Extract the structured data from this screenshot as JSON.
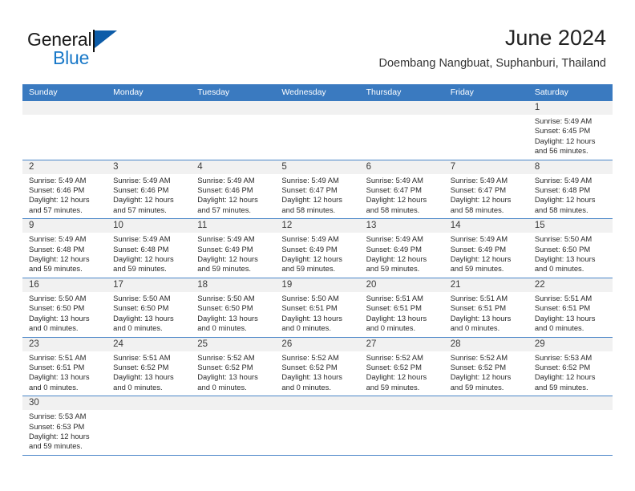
{
  "brand": {
    "name_top": "General",
    "name_bottom": "Blue",
    "logo_icon": "blue-flag-triangle",
    "color_primary": "#1878c8",
    "color_dark": "#0d5ca8"
  },
  "header": {
    "month_title": "June 2024",
    "location": "Doembang Nangbuat, Suphanburi, Thailand"
  },
  "calendar": {
    "header_bg": "#3a7ac0",
    "daynum_bg": "#f1f1f1",
    "row_border": "#4a86c8",
    "weekday_headers": [
      "Sunday",
      "Monday",
      "Tuesday",
      "Wednesday",
      "Thursday",
      "Friday",
      "Saturday"
    ],
    "weeks": [
      [
        {
          "day": "",
          "sunrise": "",
          "sunset": "",
          "daylight": ""
        },
        {
          "day": "",
          "sunrise": "",
          "sunset": "",
          "daylight": ""
        },
        {
          "day": "",
          "sunrise": "",
          "sunset": "",
          "daylight": ""
        },
        {
          "day": "",
          "sunrise": "",
          "sunset": "",
          "daylight": ""
        },
        {
          "day": "",
          "sunrise": "",
          "sunset": "",
          "daylight": ""
        },
        {
          "day": "",
          "sunrise": "",
          "sunset": "",
          "daylight": ""
        },
        {
          "day": "1",
          "sunrise": "Sunrise: 5:49 AM",
          "sunset": "Sunset: 6:45 PM",
          "daylight": "Daylight: 12 hours and 56 minutes."
        }
      ],
      [
        {
          "day": "2",
          "sunrise": "Sunrise: 5:49 AM",
          "sunset": "Sunset: 6:46 PM",
          "daylight": "Daylight: 12 hours and 57 minutes."
        },
        {
          "day": "3",
          "sunrise": "Sunrise: 5:49 AM",
          "sunset": "Sunset: 6:46 PM",
          "daylight": "Daylight: 12 hours and 57 minutes."
        },
        {
          "day": "4",
          "sunrise": "Sunrise: 5:49 AM",
          "sunset": "Sunset: 6:46 PM",
          "daylight": "Daylight: 12 hours and 57 minutes."
        },
        {
          "day": "5",
          "sunrise": "Sunrise: 5:49 AM",
          "sunset": "Sunset: 6:47 PM",
          "daylight": "Daylight: 12 hours and 58 minutes."
        },
        {
          "day": "6",
          "sunrise": "Sunrise: 5:49 AM",
          "sunset": "Sunset: 6:47 PM",
          "daylight": "Daylight: 12 hours and 58 minutes."
        },
        {
          "day": "7",
          "sunrise": "Sunrise: 5:49 AM",
          "sunset": "Sunset: 6:47 PM",
          "daylight": "Daylight: 12 hours and 58 minutes."
        },
        {
          "day": "8",
          "sunrise": "Sunrise: 5:49 AM",
          "sunset": "Sunset: 6:48 PM",
          "daylight": "Daylight: 12 hours and 58 minutes."
        }
      ],
      [
        {
          "day": "9",
          "sunrise": "Sunrise: 5:49 AM",
          "sunset": "Sunset: 6:48 PM",
          "daylight": "Daylight: 12 hours and 59 minutes."
        },
        {
          "day": "10",
          "sunrise": "Sunrise: 5:49 AM",
          "sunset": "Sunset: 6:48 PM",
          "daylight": "Daylight: 12 hours and 59 minutes."
        },
        {
          "day": "11",
          "sunrise": "Sunrise: 5:49 AM",
          "sunset": "Sunset: 6:49 PM",
          "daylight": "Daylight: 12 hours and 59 minutes."
        },
        {
          "day": "12",
          "sunrise": "Sunrise: 5:49 AM",
          "sunset": "Sunset: 6:49 PM",
          "daylight": "Daylight: 12 hours and 59 minutes."
        },
        {
          "day": "13",
          "sunrise": "Sunrise: 5:49 AM",
          "sunset": "Sunset: 6:49 PM",
          "daylight": "Daylight: 12 hours and 59 minutes."
        },
        {
          "day": "14",
          "sunrise": "Sunrise: 5:49 AM",
          "sunset": "Sunset: 6:49 PM",
          "daylight": "Daylight: 12 hours and 59 minutes."
        },
        {
          "day": "15",
          "sunrise": "Sunrise: 5:50 AM",
          "sunset": "Sunset: 6:50 PM",
          "daylight": "Daylight: 13 hours and 0 minutes."
        }
      ],
      [
        {
          "day": "16",
          "sunrise": "Sunrise: 5:50 AM",
          "sunset": "Sunset: 6:50 PM",
          "daylight": "Daylight: 13 hours and 0 minutes."
        },
        {
          "day": "17",
          "sunrise": "Sunrise: 5:50 AM",
          "sunset": "Sunset: 6:50 PM",
          "daylight": "Daylight: 13 hours and 0 minutes."
        },
        {
          "day": "18",
          "sunrise": "Sunrise: 5:50 AM",
          "sunset": "Sunset: 6:50 PM",
          "daylight": "Daylight: 13 hours and 0 minutes."
        },
        {
          "day": "19",
          "sunrise": "Sunrise: 5:50 AM",
          "sunset": "Sunset: 6:51 PM",
          "daylight": "Daylight: 13 hours and 0 minutes."
        },
        {
          "day": "20",
          "sunrise": "Sunrise: 5:51 AM",
          "sunset": "Sunset: 6:51 PM",
          "daylight": "Daylight: 13 hours and 0 minutes."
        },
        {
          "day": "21",
          "sunrise": "Sunrise: 5:51 AM",
          "sunset": "Sunset: 6:51 PM",
          "daylight": "Daylight: 13 hours and 0 minutes."
        },
        {
          "day": "22",
          "sunrise": "Sunrise: 5:51 AM",
          "sunset": "Sunset: 6:51 PM",
          "daylight": "Daylight: 13 hours and 0 minutes."
        }
      ],
      [
        {
          "day": "23",
          "sunrise": "Sunrise: 5:51 AM",
          "sunset": "Sunset: 6:51 PM",
          "daylight": "Daylight: 13 hours and 0 minutes."
        },
        {
          "day": "24",
          "sunrise": "Sunrise: 5:51 AM",
          "sunset": "Sunset: 6:52 PM",
          "daylight": "Daylight: 13 hours and 0 minutes."
        },
        {
          "day": "25",
          "sunrise": "Sunrise: 5:52 AM",
          "sunset": "Sunset: 6:52 PM",
          "daylight": "Daylight: 13 hours and 0 minutes."
        },
        {
          "day": "26",
          "sunrise": "Sunrise: 5:52 AM",
          "sunset": "Sunset: 6:52 PM",
          "daylight": "Daylight: 13 hours and 0 minutes."
        },
        {
          "day": "27",
          "sunrise": "Sunrise: 5:52 AM",
          "sunset": "Sunset: 6:52 PM",
          "daylight": "Daylight: 12 hours and 59 minutes."
        },
        {
          "day": "28",
          "sunrise": "Sunrise: 5:52 AM",
          "sunset": "Sunset: 6:52 PM",
          "daylight": "Daylight: 12 hours and 59 minutes."
        },
        {
          "day": "29",
          "sunrise": "Sunrise: 5:53 AM",
          "sunset": "Sunset: 6:52 PM",
          "daylight": "Daylight: 12 hours and 59 minutes."
        }
      ],
      [
        {
          "day": "30",
          "sunrise": "Sunrise: 5:53 AM",
          "sunset": "Sunset: 6:53 PM",
          "daylight": "Daylight: 12 hours and 59 minutes."
        },
        {
          "day": "",
          "sunrise": "",
          "sunset": "",
          "daylight": ""
        },
        {
          "day": "",
          "sunrise": "",
          "sunset": "",
          "daylight": ""
        },
        {
          "day": "",
          "sunrise": "",
          "sunset": "",
          "daylight": ""
        },
        {
          "day": "",
          "sunrise": "",
          "sunset": "",
          "daylight": ""
        },
        {
          "day": "",
          "sunrise": "",
          "sunset": "",
          "daylight": ""
        },
        {
          "day": "",
          "sunrise": "",
          "sunset": "",
          "daylight": ""
        }
      ]
    ]
  }
}
